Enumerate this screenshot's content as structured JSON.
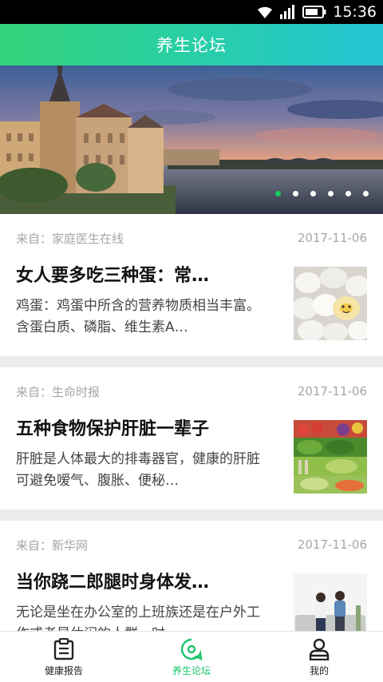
{
  "status_bar": {
    "time": "15:36"
  },
  "header": {
    "title": "养生论坛"
  },
  "banner": {
    "total_slides": 6,
    "active_index": 0
  },
  "articles": [
    {
      "source": "来自：家庭医生在线",
      "date": "2017-11-06",
      "title": "女人要多吃三种蛋：常…",
      "summary": "鸡蛋：鸡蛋中所含的营养物质相当丰富。含蛋白质、磷脂、维生素A…",
      "thumbnail": "eggs-image"
    },
    {
      "source": "来自：生命时报",
      "date": "2017-11-06",
      "title": "五种食物保护肝脏一辈子",
      "summary": "肝脏是人体最大的排毒器官，健康的肝脏可避免嗳气、腹胀、便秘…",
      "thumbnail": "vegetables-image"
    },
    {
      "source": "来自：新华网",
      "date": "2017-11-06",
      "title": "当你跷二郎腿时身体发…",
      "summary": "无论是坐在办公室的上班族还是在户外工作或者是休闲的人群，时…",
      "thumbnail": "couple-sofa-image"
    }
  ],
  "bottom_nav": [
    {
      "label": "健康报告",
      "icon": "clipboard-icon",
      "active": false
    },
    {
      "label": "养生论坛",
      "icon": "forum-chat-icon",
      "active": true
    },
    {
      "label": "我的",
      "icon": "person-icon",
      "active": false
    }
  ],
  "colors": {
    "accent": "#1ccb5e",
    "header_start": "#33d27a",
    "header_end": "#25c4d6"
  }
}
